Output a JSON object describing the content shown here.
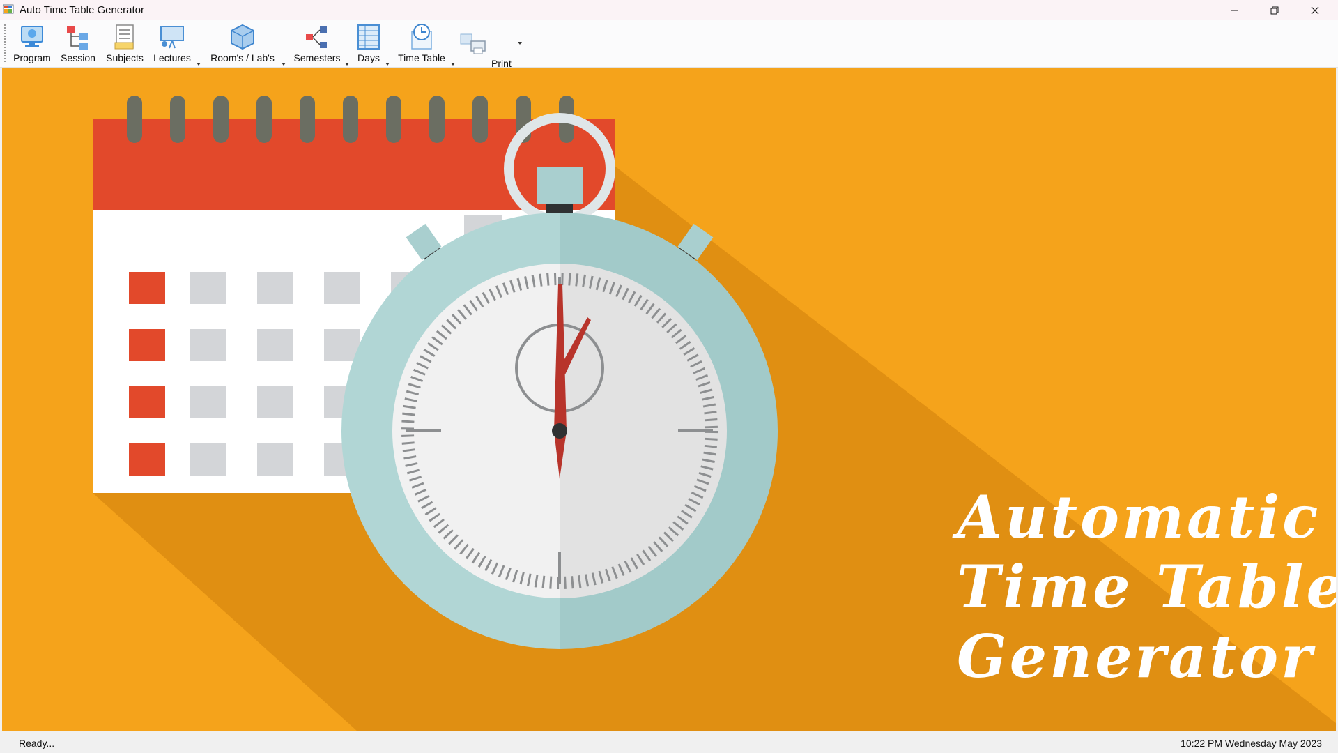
{
  "window": {
    "title": "Auto Time Table Generator"
  },
  "toolbar": {
    "program": "Program",
    "session": "Session",
    "subjects": "Subjects",
    "lectures": "Lectures",
    "rooms": "Room's / Lab's",
    "semesters": "Semesters",
    "days": "Days",
    "timetable": "Time Table",
    "print": "Print"
  },
  "banner": {
    "line1": "Automatic",
    "line2": "Time Table",
    "line3": "Generator",
    "colors": {
      "background": "#f5a31b",
      "calendar_header": "#e2492b",
      "clock_rim": "#a9cfcf",
      "hand": "#b8342b"
    }
  },
  "status": {
    "left": "Ready...",
    "right": "10:22 PM Wednesday May 2023"
  }
}
